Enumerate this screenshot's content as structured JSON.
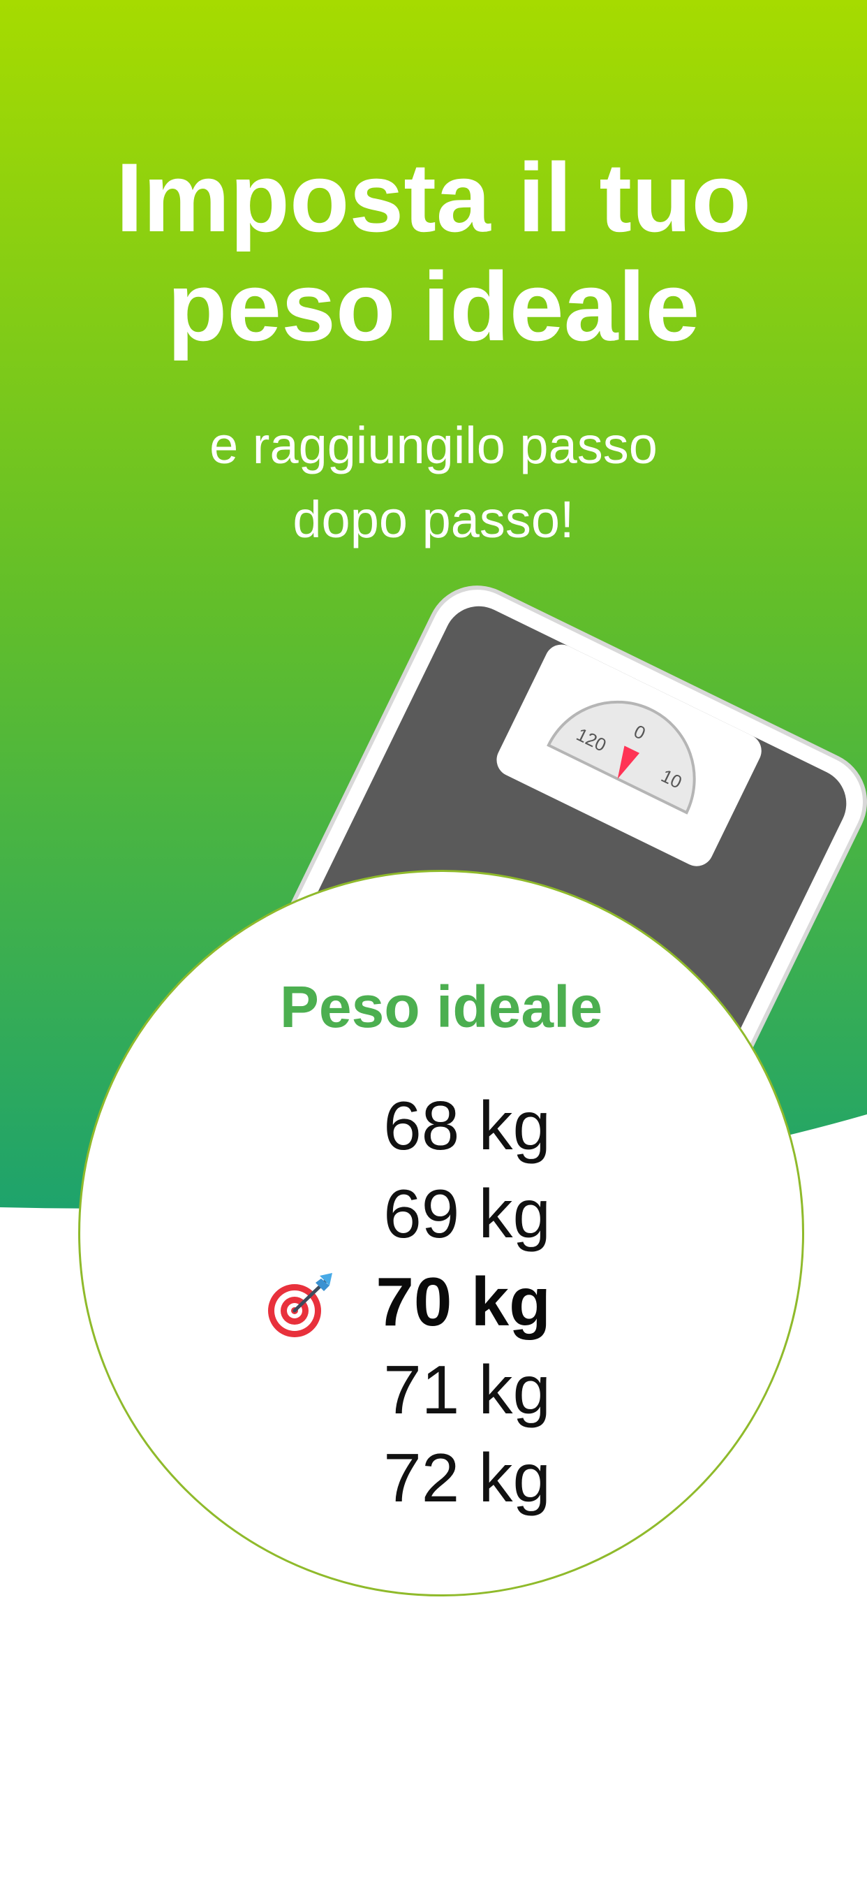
{
  "header": {
    "title_lines": [
      "Imposta il tuo",
      "peso ideale"
    ],
    "subtitle_lines": [
      "e raggiungilo passo",
      "dopo passo!"
    ]
  },
  "scale_dial": {
    "labels": [
      "120",
      "0",
      "10"
    ]
  },
  "picker": {
    "title": "Peso ideale",
    "options": [
      "68 kg",
      "69 kg",
      "70 kg",
      "71 kg",
      "72 kg"
    ],
    "selected": "70 kg",
    "selected_icon": "target-dart-icon"
  },
  "colors": {
    "gradient_top": "#a6db00",
    "gradient_mid": "#62be2a",
    "gradient_bottom": "#21a36a",
    "accent_green": "#4caf50",
    "circle_border": "#8fba2b",
    "target_red": "#e8313c"
  }
}
